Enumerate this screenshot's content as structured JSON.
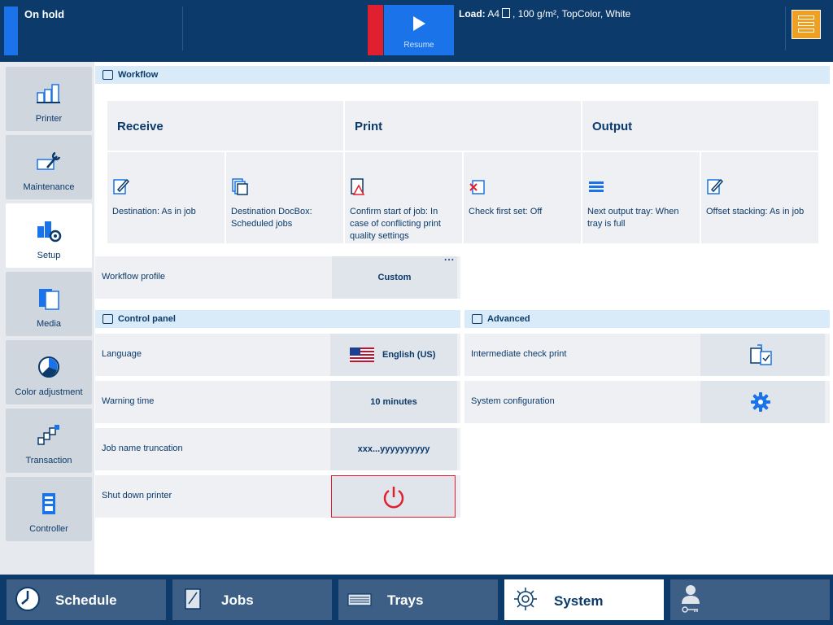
{
  "header": {
    "status": "On hold",
    "resume_label": "Resume",
    "load_key": "Load:",
    "load_value": "A4",
    "load_rest": ", 100 g/m², TopColor, White"
  },
  "sidebar": {
    "items": [
      {
        "label": "Printer"
      },
      {
        "label": "Maintenance"
      },
      {
        "label": "Setup"
      },
      {
        "label": "Media"
      },
      {
        "label": "Color adjustment"
      },
      {
        "label": "Transaction"
      },
      {
        "label": "Controller"
      }
    ]
  },
  "workflow": {
    "title": "Workflow",
    "columns": [
      "Receive",
      "Print",
      "Output"
    ],
    "tiles": [
      {
        "label": "Destination: As in job"
      },
      {
        "label": "Destination DocBox: Scheduled jobs"
      },
      {
        "label": "Confirm start of job: In case of conflicting print quality settings"
      },
      {
        "label": "Check first set: Off"
      },
      {
        "label": "Next output tray: When tray is full"
      },
      {
        "label": "Offset stacking: As in job"
      }
    ],
    "profile_label": "Workflow profile",
    "profile_value": "Custom",
    "more": "..."
  },
  "control_panel": {
    "title": "Control panel",
    "more": "...",
    "rows": [
      {
        "label": "Language",
        "value": "English (US)"
      },
      {
        "label": "Warning time",
        "value": "10 minutes"
      },
      {
        "label": "Job name truncation",
        "value": "xxx...yyyyyyyyyy"
      },
      {
        "label": "Shut down printer",
        "value": ""
      }
    ]
  },
  "advanced": {
    "title": "Advanced",
    "rows": [
      {
        "label": "Intermediate check print"
      },
      {
        "label": "System configuration"
      }
    ]
  },
  "bottom_nav": {
    "items": [
      {
        "label": "Schedule"
      },
      {
        "label": "Jobs"
      },
      {
        "label": "Trays"
      },
      {
        "label": "System"
      },
      {
        "label": ""
      }
    ]
  },
  "colors": {
    "navy": "#0b3a6b",
    "accent_blue": "#1a73e8",
    "alert_red": "#e0202e",
    "warning_orange": "#f0a020"
  }
}
